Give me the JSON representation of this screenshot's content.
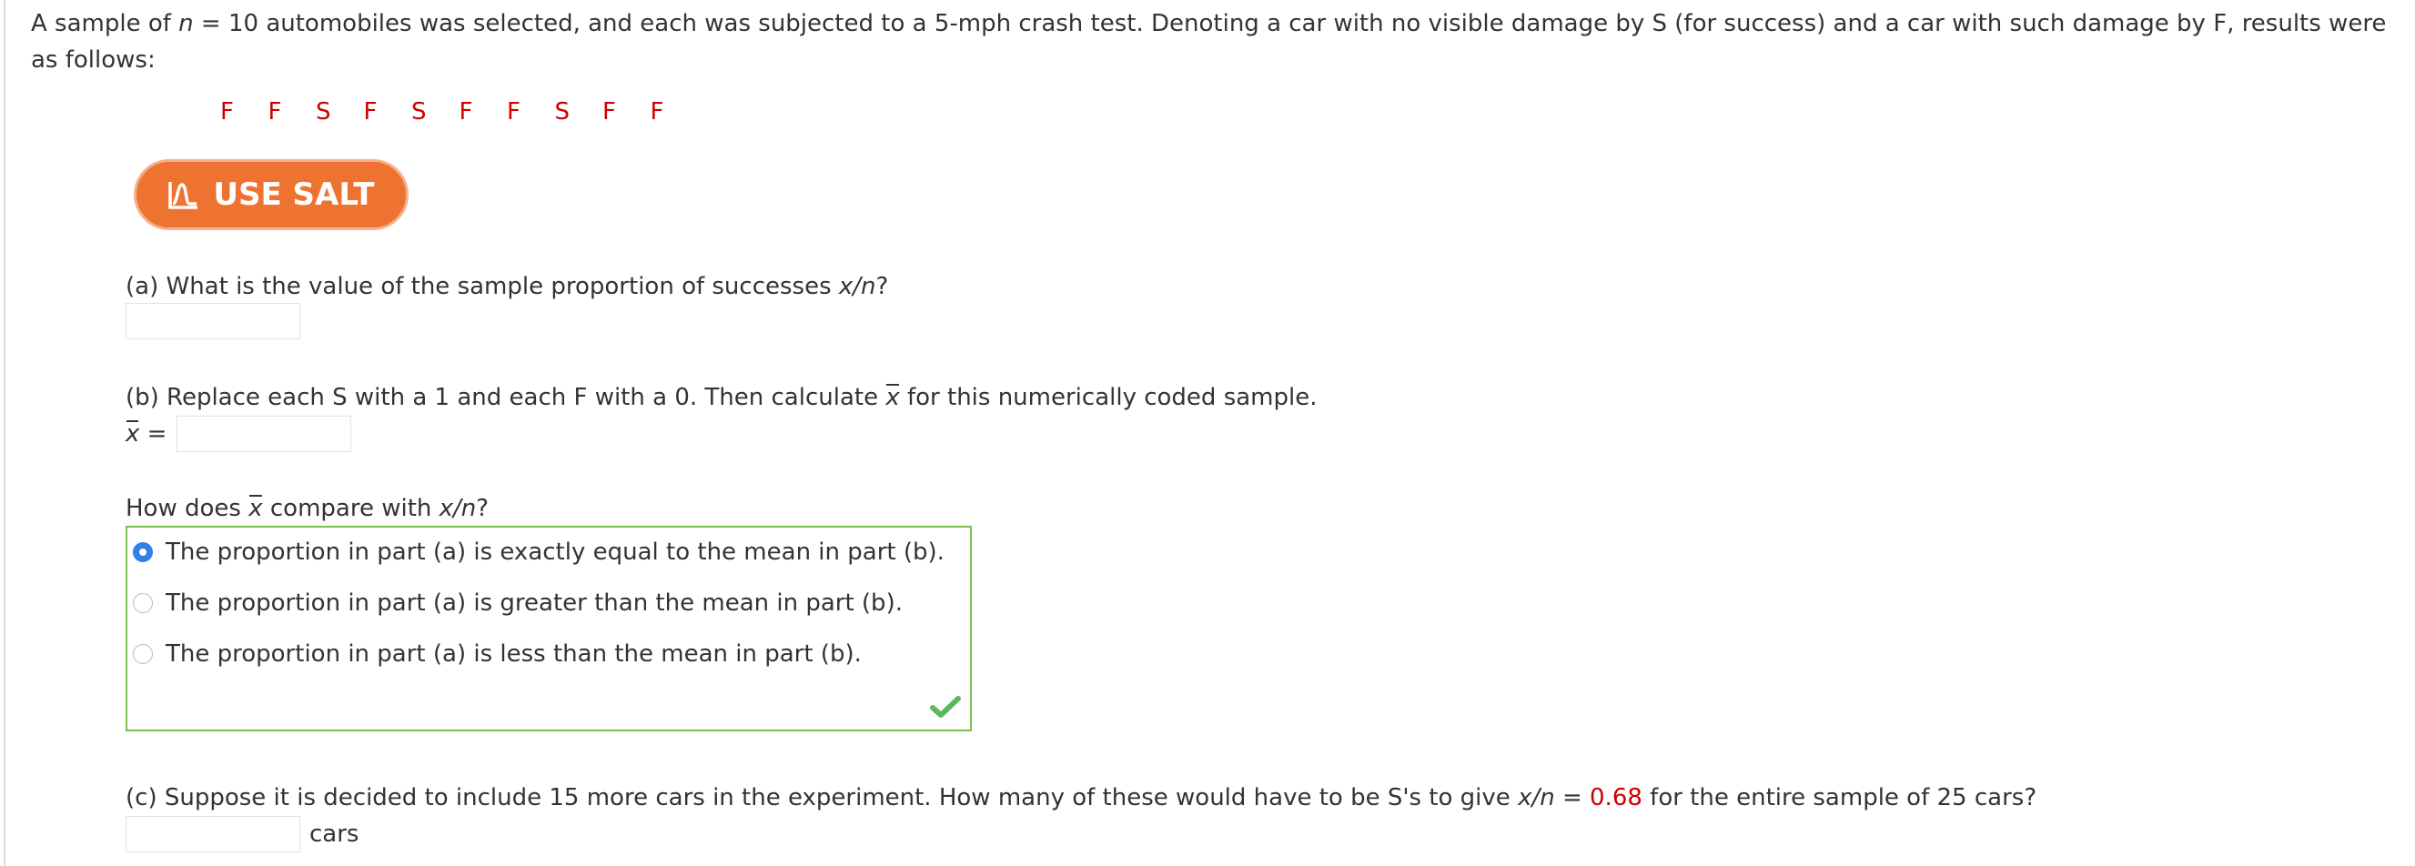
{
  "intro": {
    "part1": "A sample of ",
    "n_var": "n",
    "part2": " = 10 automobiles was selected, and each was subjected to a 5-mph crash test. Denoting a car with no visible damage by S (for success) and a car with such damage by F, results were as follows:"
  },
  "sequence": [
    "F",
    "F",
    "S",
    "F",
    "S",
    "F",
    "F",
    "S",
    "F",
    "F"
  ],
  "salt_button": {
    "label": "USE SALT",
    "icon": "salt-chart-icon"
  },
  "part_a": {
    "prefix": "(a) What is the value of the sample proportion of successes ",
    "ratio": "x/n",
    "suffix": "?",
    "answer": ""
  },
  "part_b": {
    "prefix": "(b) Replace each S with a 1 and each F with a 0. Then calculate ",
    "xbar": "x",
    "suffix": " for this numerically coded sample.",
    "xbar_label": "x",
    "equals": " =",
    "answer": ""
  },
  "compare": {
    "prefix": "How does ",
    "xbar": "x",
    "middle": " compare with ",
    "ratio": "x/n",
    "suffix": "?",
    "options": [
      {
        "label": "The proportion in part (a) is exactly equal to the mean in part (b).",
        "selected": true
      },
      {
        "label": "The proportion in part (a) is greater than the mean in part (b).",
        "selected": false
      },
      {
        "label": "The proportion in part (a) is less than the mean in part (b).",
        "selected": false
      }
    ],
    "status_icon": "checkmark-icon",
    "status_color": "#5cb85c",
    "box_color": "#7cbf55"
  },
  "part_c": {
    "prefix": "(c) Suppose it is decided to include 15 more cars in the experiment. How many of these would have to be S's to give ",
    "ratio": "x/n",
    "equals": " = ",
    "value": "0.68",
    "suffix": " for the entire sample of 25 cars?",
    "unit": "cars",
    "answer": ""
  },
  "colors": {
    "accent_red": "#cc0000",
    "salt_orange": "#ee7330",
    "radio_blue": "#2f80e8"
  }
}
